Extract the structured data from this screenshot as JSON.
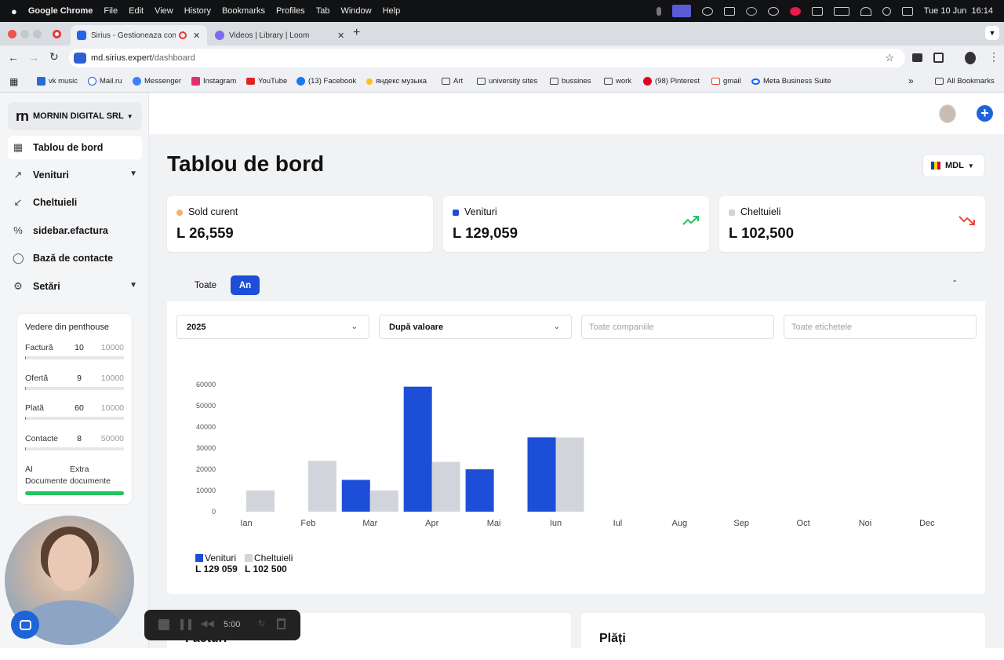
{
  "macos_menubar": {
    "app": "Google Chrome",
    "items": [
      "File",
      "Edit",
      "View",
      "History",
      "Bookmarks",
      "Profiles",
      "Tab",
      "Window",
      "Help"
    ],
    "clock": "Tue 10 Jun  16:14"
  },
  "browser": {
    "tabs": [
      {
        "title": "Sirius - Gestioneaza cont"
      },
      {
        "title": "Videos | Library | Loom"
      }
    ],
    "url_host": "md.sirius.expert",
    "url_path": "/dashboard",
    "bookmarks": [
      "vk music",
      "Mail.ru",
      "Messenger",
      "Instagram",
      "YouTube",
      "(13) Facebook",
      "яндекс музыка",
      "Art",
      "university sites",
      "bussines",
      "work",
      "(98) Pinterest",
      "gmail",
      "Meta Business Suite"
    ],
    "all_bookmarks": "All Bookmarks"
  },
  "sidebar": {
    "company": "MORNIN DIGITAL SRL",
    "logo_text": "rn",
    "nav": [
      {
        "label": "Tablou de bord",
        "icon": "grid-icon"
      },
      {
        "label": "Venituri",
        "icon": "arrow-up-right-icon"
      },
      {
        "label": "Cheltuieli",
        "icon": "arrow-down-left-icon"
      },
      {
        "label": "sidebar.efactura",
        "icon": "percent-icon"
      },
      {
        "label": "Bază de contacte",
        "icon": "contacts-icon"
      },
      {
        "label": "Setări",
        "icon": "gear-icon"
      }
    ],
    "plan": {
      "title": "Vedere din penthouse",
      "rows": [
        {
          "label": "Factură",
          "count": "10",
          "limit": "10000",
          "fraction": 0.001
        },
        {
          "label": "Ofertă",
          "count": "9",
          "limit": "10000",
          "fraction": 0.0009
        },
        {
          "label": "Plată",
          "count": "60",
          "limit": "10000",
          "fraction": 0.006
        },
        {
          "label": "Contacte",
          "count": "8",
          "limit": "50000",
          "fraction": 0.0002
        }
      ],
      "ai_label": "AI Documente",
      "ai_value": "Extra documente",
      "ai_fraction": 1.0
    }
  },
  "dashboard": {
    "title": "Tablou de bord",
    "currency": "MDL",
    "cards": [
      {
        "title": "Sold curent",
        "value": "L 26,559",
        "dot_color": "#f6b26b"
      },
      {
        "title": "Venituri",
        "value": "L 129,059",
        "dot_color": "#1d4ed8",
        "trend": "trend-up-icon"
      },
      {
        "title": "Cheltuieli",
        "value": "L 102,500",
        "dot_color": "#d1d5db",
        "trend": "trend-down-icon"
      }
    ],
    "period_tabs": [
      "Toate",
      "An"
    ],
    "active_period": "An",
    "filters": {
      "year": "2025",
      "sort": "După valoare",
      "companies_placeholder": "Toate companiile",
      "labels_placeholder": "Toate etichetele"
    },
    "legend": [
      {
        "name": "Venituri",
        "total": "L 129 059",
        "color": "#1d4ed8"
      },
      {
        "name": "Cheltuieli",
        "total": "L 102 500",
        "color": "#d1d5db"
      }
    ],
    "bottom_panels": [
      "Facturi",
      "Plăți"
    ]
  },
  "chart_data": {
    "type": "bar",
    "categories": [
      "Ian",
      "Feb",
      "Mar",
      "Apr",
      "Mai",
      "Iun",
      "Iul",
      "Aug",
      "Sep",
      "Oct",
      "Noi",
      "Dec"
    ],
    "series": [
      {
        "name": "Venituri",
        "color": "#1d4ed8",
        "values": [
          0,
          0,
          15000,
          59000,
          20000,
          35059,
          0,
          0,
          0,
          0,
          0,
          0
        ]
      },
      {
        "name": "Cheltuieli",
        "color": "#d1d5db",
        "values": [
          10000,
          24000,
          10000,
          23500,
          0,
          35000,
          0,
          0,
          0,
          0,
          0,
          0
        ]
      }
    ],
    "ylim": [
      0,
      60000
    ],
    "yticks": [
      0,
      10000,
      20000,
      30000,
      40000,
      50000,
      60000
    ],
    "grid": false,
    "legend": "bottom-left"
  },
  "recorder": {
    "time": "5:00"
  }
}
